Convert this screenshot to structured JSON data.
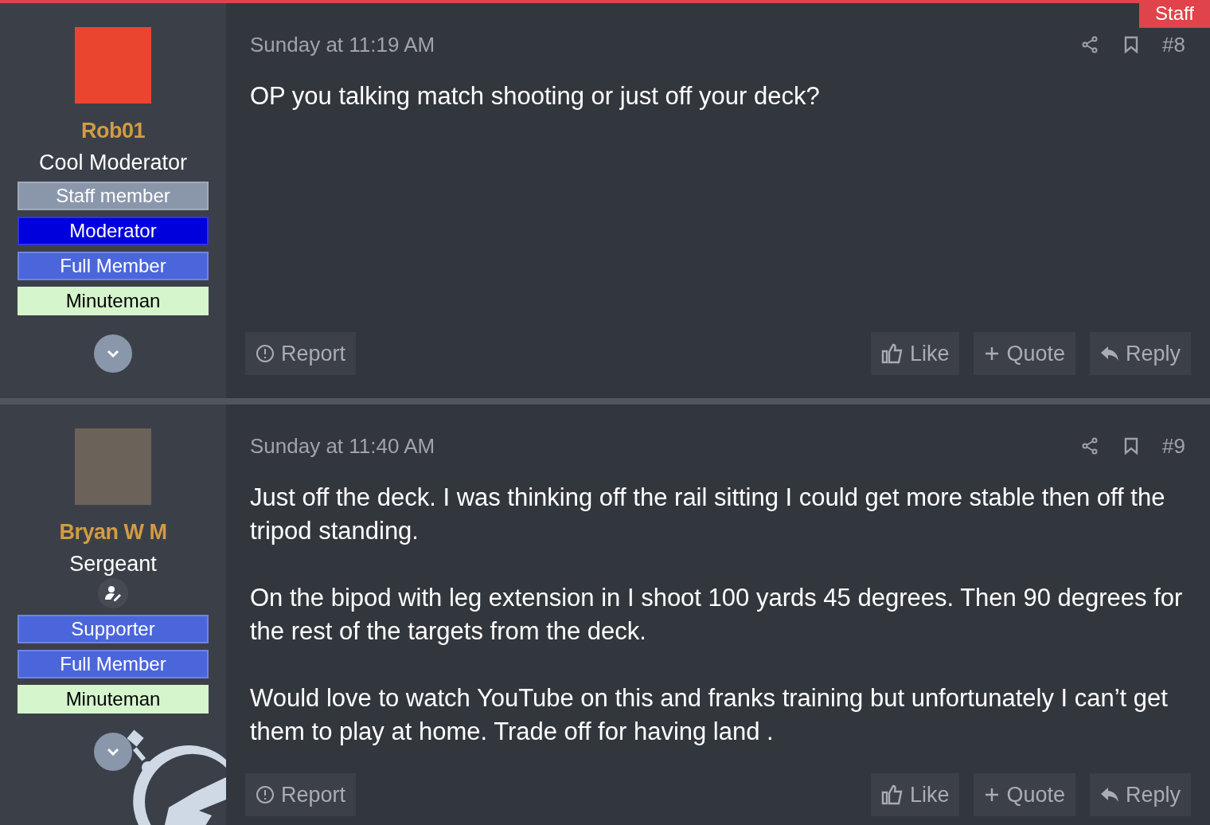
{
  "posts": [
    {
      "author": {
        "name": "Rob01",
        "title": "Cool Moderator",
        "edit_badge": false,
        "banners": [
          {
            "label": "Staff member",
            "color": "#8a97ab"
          },
          {
            "label": "Moderator",
            "color": "#0000dd"
          },
          {
            "label": "Full Member",
            "color": "#4b66db"
          },
          {
            "label": "Minuteman",
            "color": "#d5f5cc"
          }
        ]
      },
      "ribbon": "Staff",
      "time": "Sunday at 11:19 AM",
      "number": "#8",
      "body": [
        "OP you talking match shooting or just off your deck?"
      ],
      "actions": {
        "left": [
          "Report"
        ],
        "right": [
          "Like",
          "Quote",
          "Reply"
        ]
      }
    },
    {
      "author": {
        "name": "Bryan W M",
        "title": "Sergeant",
        "edit_badge": true,
        "banners": [
          {
            "label": "Supporter",
            "color": "#4b66db"
          },
          {
            "label": "Full Member",
            "color": "#4b66db"
          },
          {
            "label": "Minuteman",
            "color": "#d5f5cc"
          }
        ]
      },
      "time": "Sunday at 11:40 AM",
      "number": "#9",
      "body": [
        "Just off the deck. I was thinking off the rail sitting I could get more stable then off the tripod standing.",
        "On the bipod with leg extension in I shoot 100 yards 45 degrees. Then 90 degrees for the rest of the targets from the deck.",
        "Would love to watch YouTube on this and franks training but unfortunately I can’t get them to play at home. Trade off for having land ."
      ],
      "actions": {
        "left": [
          "Report"
        ],
        "right": [
          "Like",
          "Quote",
          "Reply"
        ]
      }
    }
  ]
}
